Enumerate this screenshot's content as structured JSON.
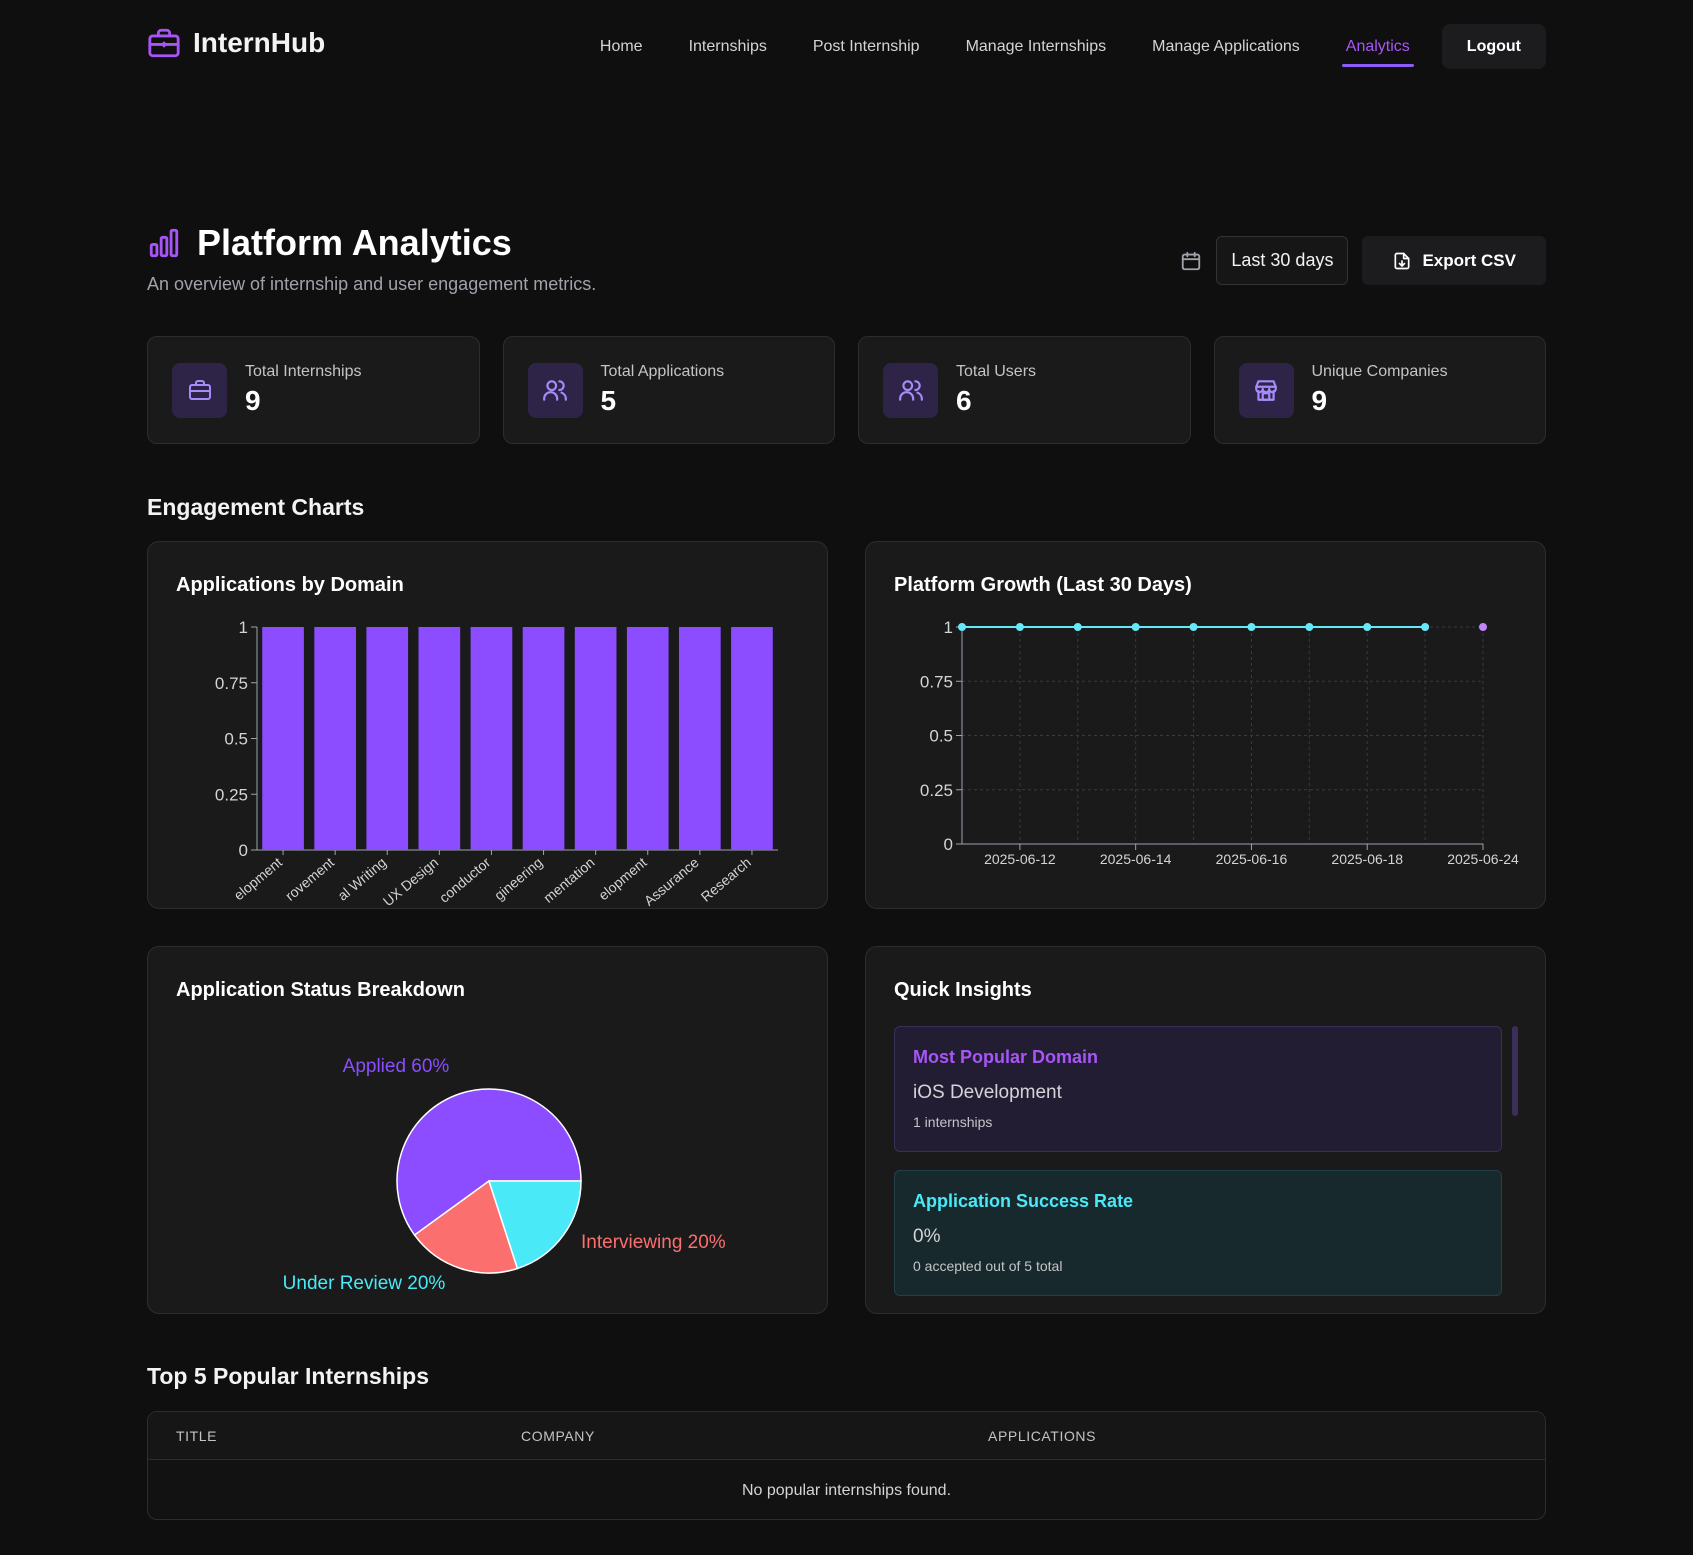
{
  "brand": {
    "name": "InternHub"
  },
  "nav": {
    "links": [
      "Home",
      "Internships",
      "Post Internship",
      "Manage Internships",
      "Manage Applications",
      "Analytics"
    ],
    "active": "Analytics",
    "logout": "Logout"
  },
  "header": {
    "title": "Platform Analytics",
    "subtitle": "An overview of internship and user engagement metrics.",
    "range": "Last 30 days",
    "export": "Export CSV"
  },
  "stats": [
    {
      "label": "Total Internships",
      "value": "9",
      "icon": "briefcase-icon"
    },
    {
      "label": "Total Applications",
      "value": "5",
      "icon": "users-icon"
    },
    {
      "label": "Total Users",
      "value": "6",
      "icon": "users-icon"
    },
    {
      "label": "Unique Companies",
      "value": "9",
      "icon": "store-icon"
    }
  ],
  "sections": {
    "engagement": "Engagement Charts",
    "top5": "Top 5 Popular Internships"
  },
  "panels": {
    "domain": "Applications by Domain",
    "growth": "Platform Growth (Last 30 Days)",
    "status": "Application Status Breakdown",
    "insights": "Quick Insights"
  },
  "insights": {
    "popular": {
      "title": "Most Popular Domain",
      "value": "iOS Development",
      "sub": "1 internships"
    },
    "success": {
      "title": "Application Success Rate",
      "value": "0%",
      "sub": "0 accepted out of 5 total"
    }
  },
  "table": {
    "headers": [
      "TITLE",
      "COMPANY",
      "APPLICATIONS"
    ],
    "empty": "No popular internships found."
  },
  "chart_data": [
    {
      "type": "bar",
      "title": "Applications by Domain",
      "categories": [
        "elopment",
        "rovement",
        "al Writing",
        "UX Design",
        "conductor",
        "gineering",
        "mentation",
        "elopment",
        "Assurance",
        "Research"
      ],
      "values": [
        1,
        1,
        1,
        1,
        1,
        1,
        1,
        1,
        1,
        1
      ],
      "ylim": [
        0,
        1
      ],
      "yticks": [
        "0",
        "0.25",
        "0.5",
        "0.75",
        "1"
      ],
      "color": "#8b4dff"
    },
    {
      "type": "line",
      "title": "Platform Growth (Last 30 Days)",
      "x": [
        "2025-06-11",
        "2025-06-12",
        "2025-06-13",
        "2025-06-14",
        "2025-06-15",
        "2025-06-16",
        "2025-06-17",
        "2025-06-18",
        "2025-06-19",
        "2025-06-20"
      ],
      "xticks": [
        "2025-06-12",
        "2025-06-14",
        "2025-06-16",
        "2025-06-18",
        "2025-06-24"
      ],
      "yticks": [
        "0",
        "0.25",
        "0.5",
        "0.75",
        "1"
      ],
      "ylim": [
        0,
        1
      ],
      "series": [
        {
          "values": [
            1,
            1,
            1,
            1,
            1,
            1,
            1,
            1,
            1
          ],
          "color": "#67e8f9"
        },
        {
          "values": [
            null,
            null,
            null,
            null,
            null,
            null,
            null,
            null,
            null,
            1
          ],
          "color": "#c084fc"
        }
      ]
    },
    {
      "type": "pie",
      "title": "Application Status Breakdown",
      "slices": [
        {
          "label": "Applied",
          "value": 60,
          "color": "#8b4dff",
          "text": "Applied 60%"
        },
        {
          "label": "Interviewing",
          "value": 20,
          "color": "#fb6f6f",
          "text": "Interviewing 20%"
        },
        {
          "label": "Under Review",
          "value": 20,
          "color": "#4ae9f8",
          "text": "Under Review 20%"
        }
      ]
    }
  ],
  "colors": {
    "accent": "#8b5cf6",
    "cyan": "#4ae9f8",
    "coral": "#fb6f6f"
  }
}
